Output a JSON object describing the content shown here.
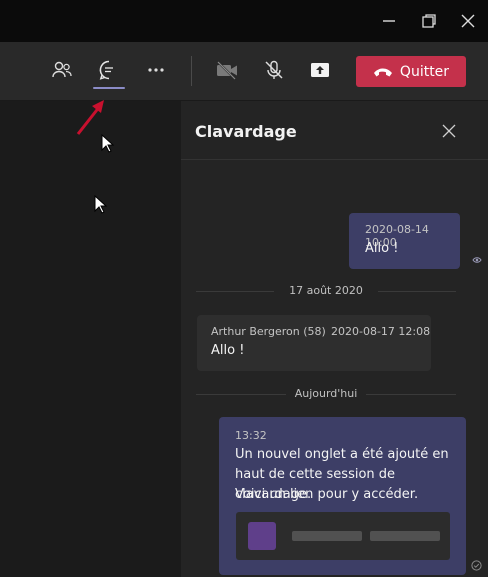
{
  "toolbar": {
    "icons": [
      "people-icon",
      "chat-icon",
      "more-icon",
      "camera-off-icon",
      "mic-off-icon",
      "share-tray-icon"
    ],
    "leave_label": "Quitter"
  },
  "chat": {
    "title": "Clavardage",
    "messages": [
      {
        "time": "2020-08-14 10:00",
        "text": "Allo !"
      },
      {
        "author": "Arthur Bergeron (58)",
        "time": "2020-08-17 12:08",
        "text": "Allo !"
      },
      {
        "time": "13:32",
        "lines": [
          "Un nouvel onglet a été ajouté en",
          "haut de cette session de clavardage.",
          "Voici un lien pour y accéder."
        ]
      }
    ],
    "dividers": [
      "17 août 2020",
      "Aujourd'hui"
    ]
  },
  "colors": {
    "accent": "#8b8cc7",
    "leave": "#c4314b",
    "self_bubble": "#3d3e66"
  }
}
